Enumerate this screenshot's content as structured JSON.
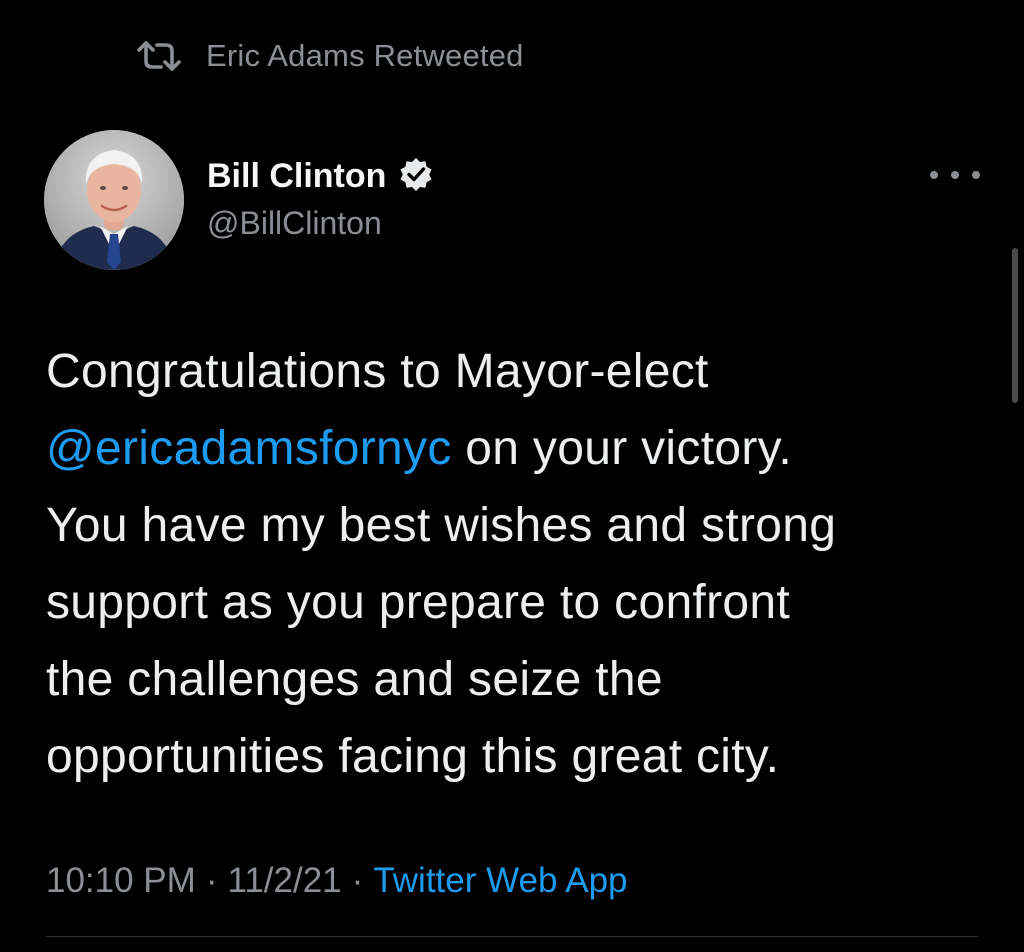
{
  "colors": {
    "background": "#000000",
    "text_primary": "#e7e9ea",
    "text_secondary": "#8b8f94",
    "accent_link": "#1d9bf0"
  },
  "social_context": {
    "icon": "retweet-icon",
    "text": "Eric Adams Retweeted"
  },
  "author": {
    "display_name": "Bill Clinton",
    "handle": "@BillClinton",
    "verified_icon": "verified-badge-icon",
    "avatar": "profile-photo"
  },
  "more_menu_icon": "more-horizontal-icon",
  "tweet": {
    "lines": [
      {
        "text": "Congratulations to Mayor-elect"
      },
      {
        "mention": "@ericadamsfornyc",
        "text": " on your victory."
      },
      {
        "text": "You have my best wishes and strong"
      },
      {
        "text": "support as you prepare to confront"
      },
      {
        "text": "the challenges and seize the"
      },
      {
        "text": "opportunities facing this great city."
      }
    ]
  },
  "meta": {
    "time": "10:10 PM",
    "separator": "·",
    "date": "11/2/21",
    "source": "Twitter Web App"
  }
}
